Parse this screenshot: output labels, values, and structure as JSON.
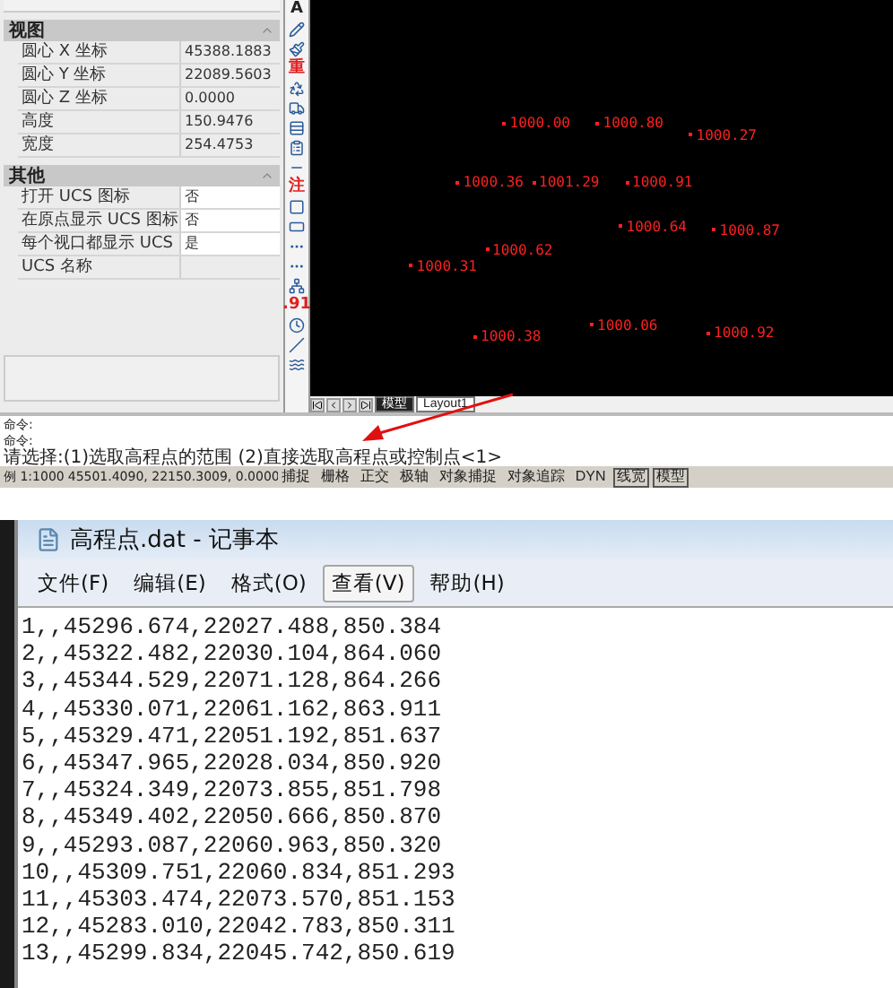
{
  "properties": {
    "sections": [
      {
        "title": "视图",
        "expanded": true,
        "rows": [
          {
            "label": "圆心 X 坐标",
            "value": "45388.1883"
          },
          {
            "label": "圆心 Y 坐标",
            "value": "22089.5603"
          },
          {
            "label": "圆心 Z 坐标",
            "value": "0.0000"
          },
          {
            "label": "高度",
            "value": "150.9476"
          },
          {
            "label": "宽度",
            "value": "254.4753"
          }
        ]
      },
      {
        "title": "其他",
        "expanded": true,
        "rows": [
          {
            "label": "打开 UCS 图标",
            "value": "否",
            "editable": true
          },
          {
            "label": "在原点显示 UCS 图标",
            "value": "否",
            "editable": true
          },
          {
            "label": "每个视口都显示 UCS",
            "value": "是",
            "editable": true
          },
          {
            "label": "UCS 名称",
            "value": "",
            "editable": false
          }
        ]
      }
    ]
  },
  "toolbar": [
    {
      "kind": "text",
      "label": "A"
    },
    {
      "kind": "icon"
    },
    {
      "kind": "icon"
    },
    {
      "kind": "text",
      "label": "重",
      "color": "#e02020"
    },
    {
      "kind": "icon"
    },
    {
      "kind": "icon"
    },
    {
      "kind": "icon"
    },
    {
      "kind": "icon"
    },
    {
      "kind": "icon"
    },
    {
      "kind": "text",
      "label": "注",
      "color": "#e02020"
    },
    {
      "kind": "icon"
    },
    {
      "kind": "icon"
    },
    {
      "kind": "icon"
    },
    {
      "kind": "icon"
    },
    {
      "kind": "icon"
    },
    {
      "kind": "text",
      "label": ".91",
      "color": "#e02020"
    },
    {
      "kind": "icon"
    },
    {
      "kind": "icon"
    },
    {
      "kind": "icon"
    }
  ],
  "canvas": {
    "points": [
      {
        "label": "1000.00"
      },
      {
        "label": "1000.80"
      },
      {
        "label": "1000.27"
      },
      {
        "label": "1000.36"
      },
      {
        "label": "1001.29"
      },
      {
        "label": "1000.91"
      },
      {
        "label": "1000.64"
      },
      {
        "label": "1000.87"
      },
      {
        "label": "1000.62"
      },
      {
        "label": "1000.31"
      },
      {
        "label": "1000.38"
      },
      {
        "label": "1000.06"
      },
      {
        "label": "1000.92"
      }
    ]
  },
  "layout_tabs": [
    {
      "label": "模型",
      "selected": true
    },
    {
      "label": "Layout1",
      "selected": false
    }
  ],
  "command_lines": [
    "命令:",
    "命令:",
    "请选择:(1)选取高程点的范围 (2)直接选取高程点或控制点<1>"
  ],
  "status_bar": {
    "scale": "例 1:1000",
    "coordinates": "45501.4090, 22150.3009, 0.0000",
    "toggles": [
      {
        "label": "捕捉",
        "on": false
      },
      {
        "label": "栅格",
        "on": false
      },
      {
        "label": "正交",
        "on": false
      },
      {
        "label": "极轴",
        "on": false
      },
      {
        "label": "对象捕捉",
        "on": false
      },
      {
        "label": "对象追踪",
        "on": false
      },
      {
        "label": "DYN",
        "on": false
      },
      {
        "label": "线宽",
        "on": true
      },
      {
        "label": "模型",
        "on": true
      }
    ]
  },
  "notepad": {
    "title": "高程点.dat - 记事本",
    "menu": [
      {
        "label": "文件(F)",
        "selected": false
      },
      {
        "label": "编辑(E)",
        "selected": false
      },
      {
        "label": "格式(O)",
        "selected": false
      },
      {
        "label": "查看(V)",
        "selected": true
      },
      {
        "label": "帮助(H)",
        "selected": false
      }
    ],
    "lines": [
      "1,,45296.674,22027.488,850.384",
      "2,,45322.482,22030.104,864.060",
      "3,,45344.529,22071.128,864.266",
      "4,,45330.071,22061.162,863.911",
      "5,,45329.471,22051.192,851.637",
      "6,,45347.965,22028.034,850.920",
      "7,,45324.349,22073.855,851.798",
      "8,,45349.402,22050.666,850.870",
      "9,,45293.087,22060.963,850.320",
      "10,,45309.751,22060.834,851.293",
      "11,,45303.474,22073.570,851.153",
      "12,,45283.010,22042.783,850.311",
      "13,,45299.834,22045.742,850.619"
    ]
  }
}
